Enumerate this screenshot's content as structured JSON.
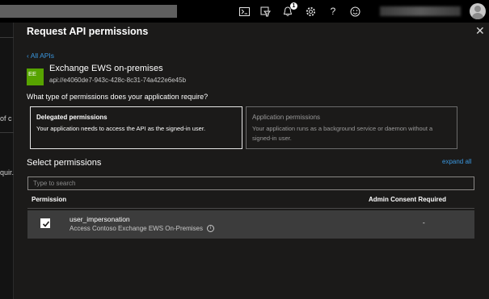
{
  "topbar": {
    "icons": [
      "cloud-shell-icon",
      "directory-filter-icon",
      "notifications-icon",
      "settings-icon",
      "help-icon",
      "feedback-icon"
    ],
    "notification_count": "1"
  },
  "background": {
    "fragments": [
      "of c",
      "quir."
    ]
  },
  "panel": {
    "title": "Request API permissions",
    "back_link": "All APIs",
    "api": {
      "logo_text": "EE",
      "logo_color": "#57a300",
      "name": "Exchange EWS on-premises",
      "uri": "api://e4060de7-943c-428c-8c31-74a422e6e45b"
    },
    "question": "What type of permissions does your application require?",
    "permission_types": [
      {
        "title": "Delegated permissions",
        "description": "Your application needs to access the API as the signed-in user.",
        "selected": true
      },
      {
        "title": "Application permissions",
        "description": "Your application runs as a background service or daemon without a signed-in user.",
        "selected": false
      }
    ],
    "select_permissions": "Select permissions",
    "expand_all": "expand all",
    "search_placeholder": "Type to search",
    "table": {
      "columns": [
        "Permission",
        "Admin Consent Required"
      ],
      "rows": [
        {
          "checked": true,
          "name": "user_impersonation",
          "description": "Access Contoso Exchange EWS On-Premises",
          "admin_consent": "-"
        }
      ]
    }
  },
  "colors": {
    "accent": "#3a96dd",
    "panel_bg": "#1b1a19",
    "row_bg": "#3c3c3c"
  }
}
